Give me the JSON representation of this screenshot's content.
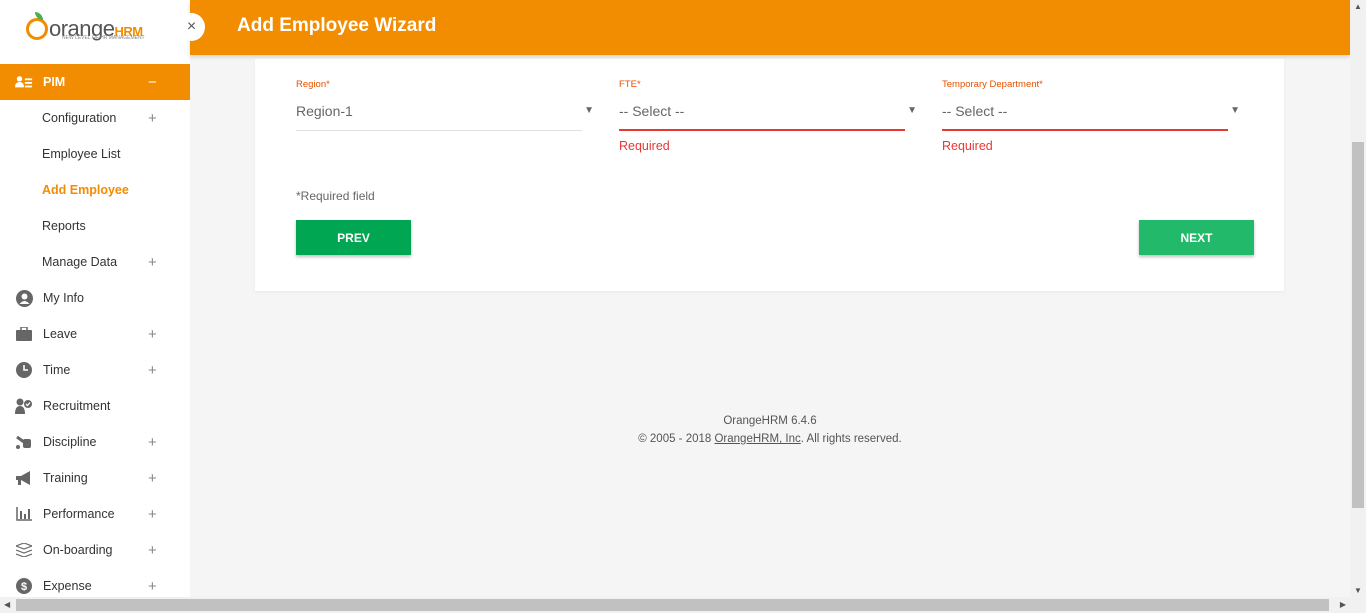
{
  "brand": {
    "name": "orange",
    "suffix": "HRM",
    "tagline": "NEW LEVEL OF HR MANAGEMENT",
    "accent": "#f28c00"
  },
  "header": {
    "title": "Add Employee Wizard",
    "collapse_icon": "×"
  },
  "sidebar": {
    "items": [
      {
        "label": "PIM",
        "icon": "pim-icon",
        "toggle": "−"
      },
      {
        "label": "Configuration",
        "toggle": "+"
      },
      {
        "label": "Employee List"
      },
      {
        "label": "Add Employee"
      },
      {
        "label": "Reports"
      },
      {
        "label": "Manage Data",
        "toggle": "+"
      },
      {
        "label": "My Info",
        "icon": "user-circle-icon"
      },
      {
        "label": "Leave",
        "icon": "briefcase-icon",
        "toggle": "+"
      },
      {
        "label": "Time",
        "icon": "clock-icon",
        "toggle": "+"
      },
      {
        "label": "Recruitment",
        "icon": "recruitment-icon"
      },
      {
        "label": "Discipline",
        "icon": "discipline-icon",
        "toggle": "+"
      },
      {
        "label": "Training",
        "icon": "megaphone-icon",
        "toggle": "+"
      },
      {
        "label": "Performance",
        "icon": "bar-chart-icon",
        "toggle": "+"
      },
      {
        "label": "On-boarding",
        "icon": "layers-icon",
        "toggle": "+"
      },
      {
        "label": "Expense",
        "icon": "dollar-icon",
        "toggle": "+"
      }
    ]
  },
  "form": {
    "fields": [
      {
        "label": "Region",
        "required_mark": "*",
        "value": "Region-1",
        "caret": "▼",
        "error": ""
      },
      {
        "label": "FTE",
        "required_mark": "*",
        "value": "-- Select --",
        "caret": "▼",
        "error": "Required"
      },
      {
        "label": "Temporary Department",
        "required_mark": "*",
        "value": "-- Select --",
        "caret": "▼",
        "error": "Required"
      }
    ],
    "required_note": "*Required field",
    "prev_label": "PREV",
    "next_label": "NEXT"
  },
  "footer": {
    "version": "OrangeHRM 6.4.6",
    "copyright_prefix": "© 2005 - 2018 ",
    "company_link": "OrangeHRM, Inc",
    "copyright_suffix": ". All rights reserved."
  },
  "colors": {
    "header_bg": "#f28c00",
    "prev_button": "#00a651",
    "next_button": "#23b96b",
    "error": "#e53935",
    "label": "#e65100"
  }
}
